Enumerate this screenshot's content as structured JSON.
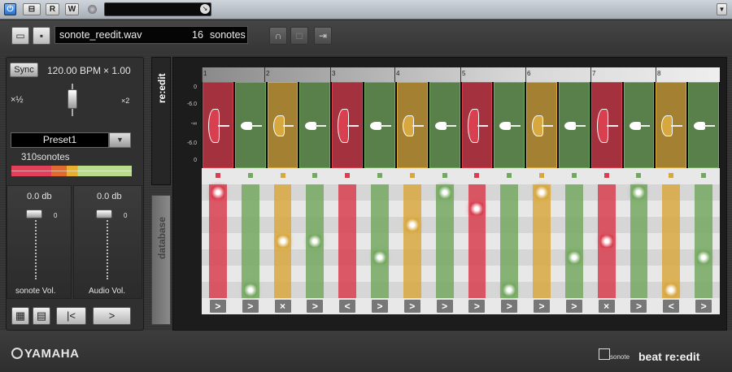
{
  "topbar": {
    "power_label": "⏻",
    "buttons": [
      "⊟",
      "R",
      "W"
    ]
  },
  "toolbar": {
    "file": "sonote_reedit.wav",
    "count": "16",
    "count_unit": "sonotes"
  },
  "left_panel": {
    "sync_label": "Sync",
    "bpm": "120.00",
    "bpm_unit": "BPM",
    "mult": "× 1.00",
    "half_label": "×½",
    "double_label": "×2",
    "preset": "Preset1",
    "sonote_count": "310sonotes",
    "fader1": {
      "value": "0.0 db",
      "zero": "0",
      "label": "sonote Vol."
    },
    "fader2": {
      "value": "0.0 db",
      "zero": "0",
      "label": "Audio Vol."
    }
  },
  "tabs": {
    "reedit": "re:edit",
    "database": "database"
  },
  "editor": {
    "ruler": [
      "1",
      "2",
      "3",
      "4",
      "5",
      "6",
      "7",
      "8"
    ],
    "scale": [
      "0",
      "-6.0",
      "-∞",
      "-6.0",
      "0"
    ],
    "colors": {
      "red": "#d84050",
      "green": "#74a860",
      "yellow": "#d8a840"
    },
    "columns": [
      {
        "color": "red",
        "pos": 0,
        "act": ">"
      },
      {
        "color": "green",
        "pos": 6,
        "act": ">"
      },
      {
        "color": "yellow",
        "pos": 3,
        "act": "×"
      },
      {
        "color": "green",
        "pos": 3,
        "act": ">"
      },
      {
        "color": "red",
        "pos": -1,
        "act": "<"
      },
      {
        "color": "green",
        "pos": 4,
        "act": ">"
      },
      {
        "color": "yellow",
        "pos": 2,
        "act": ">"
      },
      {
        "color": "green",
        "pos": 0,
        "act": ">"
      },
      {
        "color": "red",
        "pos": 1,
        "act": ">"
      },
      {
        "color": "green",
        "pos": 6,
        "act": ">"
      },
      {
        "color": "yellow",
        "pos": 0,
        "act": ">"
      },
      {
        "color": "green",
        "pos": 4,
        "act": ">"
      },
      {
        "color": "red",
        "pos": 3,
        "act": "×"
      },
      {
        "color": "green",
        "pos": 0,
        "act": ">"
      },
      {
        "color": "yellow",
        "pos": 6,
        "act": "<"
      },
      {
        "color": "green",
        "pos": 4,
        "act": ">"
      }
    ]
  },
  "footer": {
    "brand": "YAMAHA",
    "product_small": "sonote",
    "product": "beat re:edit"
  }
}
